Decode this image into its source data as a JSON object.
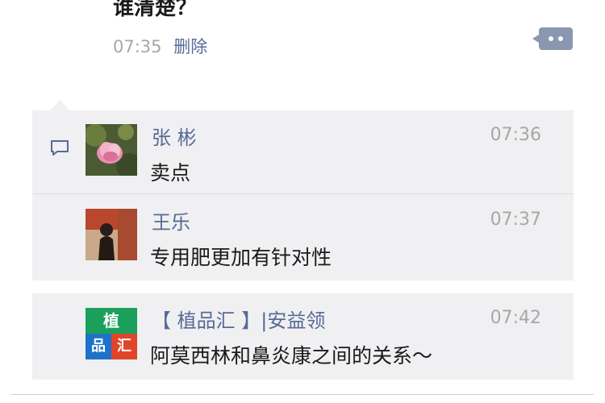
{
  "post": {
    "text_tail": "谁清楚？",
    "time": "07:35",
    "delete_label": "删除"
  },
  "comments": [
    {
      "name": "张  彬",
      "time": "07:36",
      "text": "卖点"
    },
    {
      "name": "王乐",
      "time": "07:37",
      "text": "专用肥更加有针对性"
    },
    {
      "name": "【 植品汇 】|安益领",
      "time": "07:42",
      "text": "阿莫西林和鼻炎康之间的关系～",
      "avatar_text": [
        "植",
        "品",
        "汇"
      ]
    }
  ],
  "icons": {
    "more": "more-dots-icon",
    "comment": "comment-bubble-icon"
  },
  "colors": {
    "link": "#576b95",
    "timestamp": "#a7a7a7",
    "comment_bg": "#f0f0f2",
    "more_button": "#8a97b0",
    "logo_green": "#1aa05a",
    "logo_blue": "#1c73c9",
    "logo_red": "#e0452a"
  }
}
